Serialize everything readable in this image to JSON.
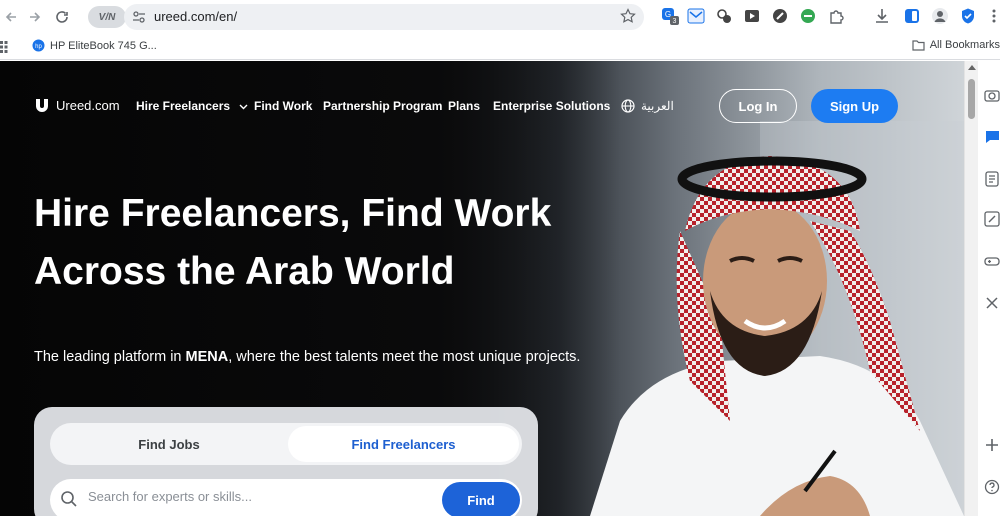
{
  "browser": {
    "url": "ureed.com/en/",
    "site_pill": "V/N",
    "bookmark_item": "HP EliteBook 745 G...",
    "all_bookmarks": "All Bookmarks",
    "extension_badge": "3"
  },
  "site": {
    "logo": "Ureed.com",
    "nav": [
      {
        "label": "Hire Freelancers"
      },
      {
        "label": "Find Work"
      },
      {
        "label": "Partnership Program"
      },
      {
        "label": "Plans"
      },
      {
        "label": "Enterprise Solutions"
      }
    ],
    "language": "العربية",
    "login": "Log In",
    "signup": "Sign Up"
  },
  "hero": {
    "headline_line1": "Hire Freelancers, Find Work",
    "headline_line2": "Across the Arab World",
    "sub_prefix": "The leading platform in ",
    "sub_bold": "MENA",
    "sub_suffix": ", where the best talents meet the most unique projects."
  },
  "search": {
    "tab_jobs": "Find Jobs",
    "tab_freelancers": "Find Freelancers",
    "placeholder": "Search for experts or skills...",
    "find": "Find"
  },
  "colors": {
    "accent": "#1d7cf2",
    "find_button": "#1d63d8",
    "hero_bg": "#0a0a0b"
  }
}
